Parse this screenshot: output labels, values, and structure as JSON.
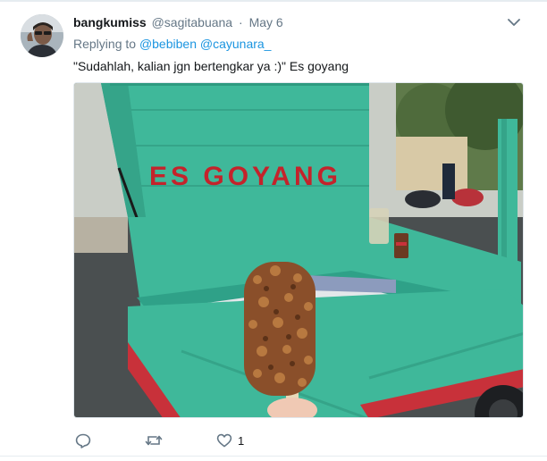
{
  "tweet": {
    "display_name": "bangkumiss",
    "handle": "@sagitabuana",
    "separator": "·",
    "date": "May 6",
    "replying_prefix": "Replying to",
    "reply_mentions": [
      "@bebiben",
      "@cayunara_"
    ],
    "text": "\"Sudahlah, kalian jgn bertengkar ya :)\" Es goyang",
    "image_sign_text": "ES GOYANG",
    "actions": {
      "reply_count": "",
      "retweet_count": "",
      "like_count": "1"
    }
  },
  "colors": {
    "link": "#1b95e0",
    "secondary_text": "#657786",
    "cart_green": "#3fb89a",
    "sign_red": "#c4232b"
  },
  "icons": {
    "caret": "chevron-down-icon",
    "reply": "reply-icon",
    "retweet": "retweet-icon",
    "like": "heart-icon"
  }
}
